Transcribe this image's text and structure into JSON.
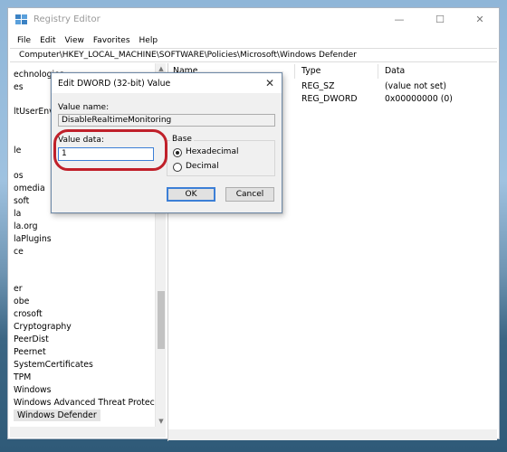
{
  "window": {
    "title": "Registry Editor",
    "minimize": "—",
    "maximize": "☐",
    "close": "✕"
  },
  "menu": [
    "File",
    "Edit",
    "View",
    "Favorites",
    "Help"
  ],
  "address": "Computer\\HKEY_LOCAL_MACHINE\\SOFTWARE\\Policies\\Microsoft\\Windows Defender",
  "tree": [
    "echnologies",
    "es",
    "ltUserEnvi",
    "",
    "",
    "le",
    "",
    "",
    "os",
    "omedia",
    "soft",
    "la",
    "la.org",
    "laPlugins",
    "ce",
    "",
    "",
    "er",
    "obe",
    "crosoft",
    "Cryptography",
    "PeerDist",
    "Peernet",
    "SystemCertificates",
    "TPM",
    "Windows",
    "Windows Advanced Threat Protectio",
    "Windows Defender"
  ],
  "list": {
    "headers": {
      "name": "Name",
      "type": "Type",
      "data": "Data"
    },
    "rows": [
      {
        "type": "REG_SZ",
        "data": "(value not set)"
      },
      {
        "type": "REG_DWORD",
        "data": "0x00000000 (0)"
      }
    ]
  },
  "dialog": {
    "title": "Edit DWORD (32-bit) Value",
    "close": "✕",
    "value_name_label": "Value name:",
    "value_name": "DisableRealtimeMonitoring",
    "value_data_label": "Value data:",
    "value_data": "1",
    "base_label": "Base",
    "hex_label": "Hexadecimal",
    "dec_label": "Decimal",
    "selected_base": "Hexadecimal",
    "ok": "OK",
    "cancel": "Cancel"
  },
  "colors": {
    "highlight_ring": "#c0202a",
    "focus_border": "#3c7fd6"
  }
}
